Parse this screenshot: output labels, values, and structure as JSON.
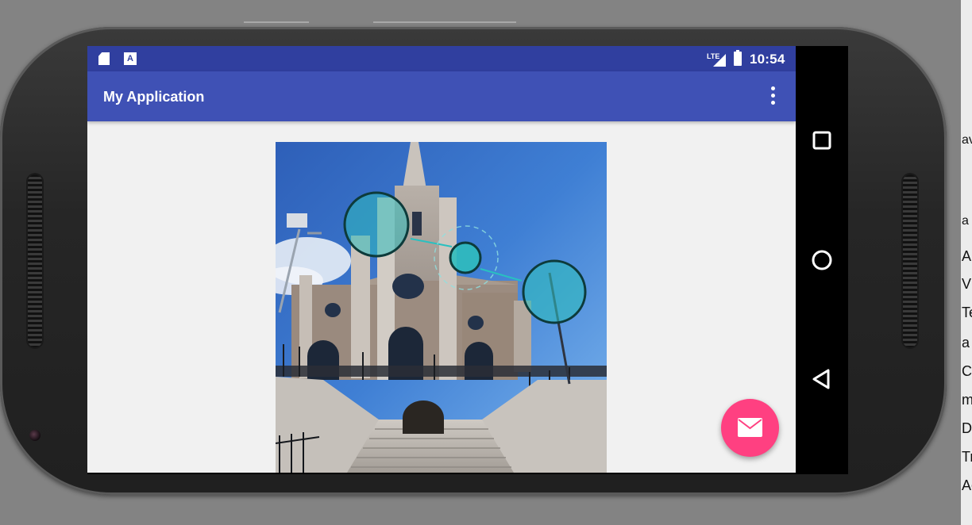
{
  "status_bar": {
    "time": "10:54",
    "network_label": "LTE",
    "icons": [
      "sd-card-icon",
      "a-notification-icon",
      "signal-icon",
      "battery-charging-icon"
    ]
  },
  "app_bar": {
    "title": "My Application",
    "overflow_icon": "more-vert-icon"
  },
  "content": {
    "image_subject": "church-facade-photo",
    "annotation_markers": [
      "bubble-left",
      "bubble-center",
      "bubble-right"
    ]
  },
  "fab": {
    "icon": "email-icon",
    "color": "#ff4081"
  },
  "navigation_bar": {
    "buttons": [
      "recents-square-icon",
      "home-circle-icon",
      "back-triangle-icon"
    ]
  },
  "colors": {
    "status_bar": "#303f9f",
    "app_bar": "#3f51b5",
    "accent": "#ff4081",
    "marker": "#26b5b5"
  },
  "ide_strip": {
    "letters": [
      "av",
      "a",
      "Al",
      "V",
      "Te",
      "a",
      "Co",
      "m",
      "Da",
      "Tr",
      "Ac"
    ]
  }
}
